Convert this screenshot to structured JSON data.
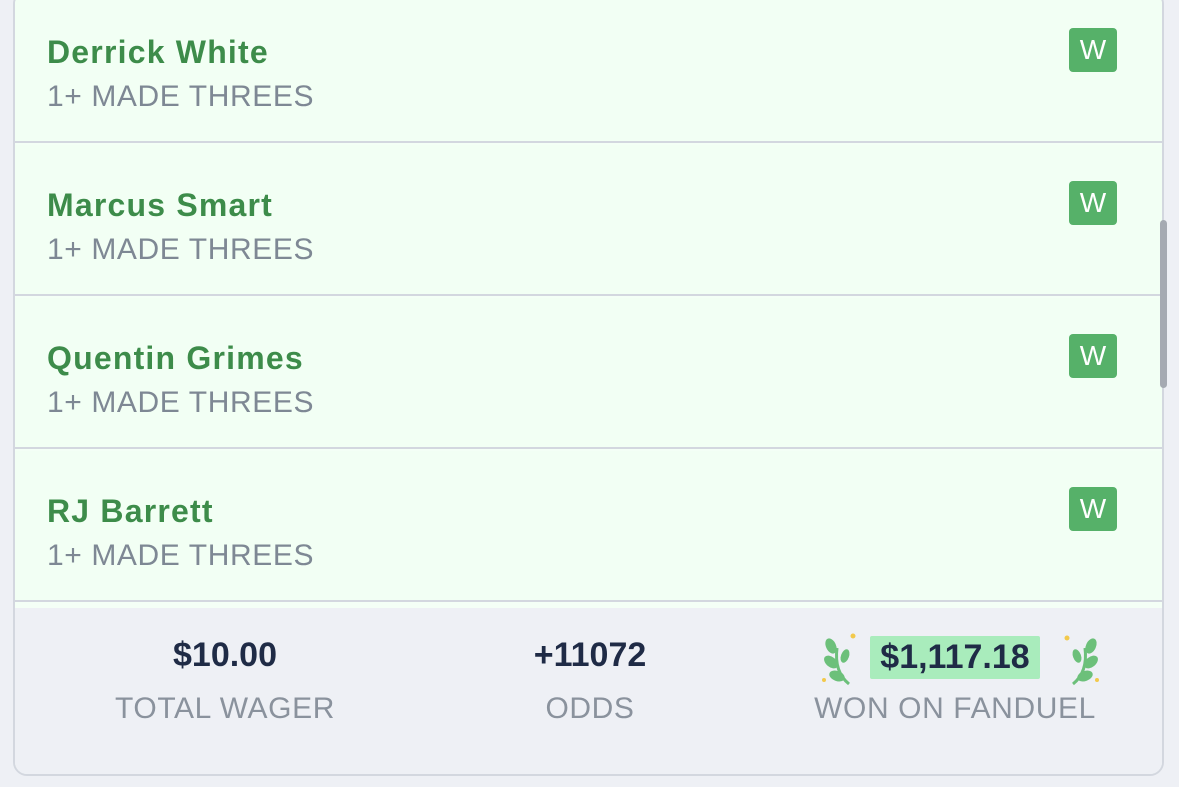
{
  "legs": [
    {
      "player": "Derrick White",
      "market": "1+ MADE THREES",
      "result": "W"
    },
    {
      "player": "Marcus Smart",
      "market": "1+ MADE THREES",
      "result": "W"
    },
    {
      "player": "Quentin Grimes",
      "market": "1+ MADE THREES",
      "result": "W"
    },
    {
      "player": "RJ Barrett",
      "market": "1+ MADE THREES",
      "result": "W"
    }
  ],
  "footer": {
    "total_wager": {
      "value": "$10.00",
      "label": "TOTAL WAGER"
    },
    "odds": {
      "value": "+11072",
      "label": "ODDS"
    },
    "payout": {
      "value": "$1,117.18",
      "label": "WON ON FANDUEL"
    }
  },
  "colors": {
    "player_name": "#3d8c4a",
    "win_badge": "#56b169",
    "payout_highlight": "#a9ecbc",
    "row_background": "#f2fff4"
  },
  "icons": {
    "laurel_left": "laurel-left-icon",
    "laurel_right": "laurel-right-icon"
  }
}
